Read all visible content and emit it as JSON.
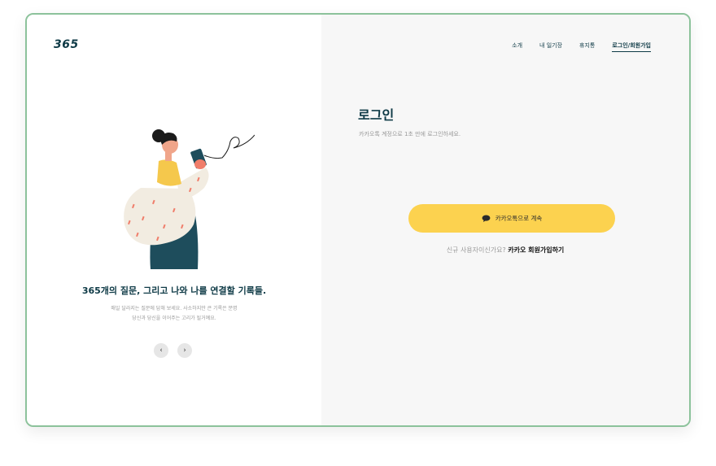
{
  "brand": {
    "logo": "365"
  },
  "nav": {
    "items": [
      {
        "label": "소개"
      },
      {
        "label": "내 일기장"
      },
      {
        "label": "휴지통"
      },
      {
        "label": "로그인/회원가입"
      }
    ],
    "active_index": 3
  },
  "intro": {
    "tagline": "365개의 질문, 그리고 나와 나를 연결할 기록들.",
    "desc_line1": "매일 달라지는 질문에 답해 보세요. 사소하지만 큰 기록은 분명",
    "desc_line2": "당신과 당신을 이어주는 고리가 될거예요."
  },
  "carousel": {
    "prev_icon": "‹",
    "next_icon": "›"
  },
  "login": {
    "title": "로그인",
    "subtitle": "카카오톡 계정으로 1초 만에 로그인하세요.",
    "kakao_button": "카카오톡으로 계속",
    "signup_prompt": "신규 사용자이신가요?",
    "signup_link": "카카오 회원가입하기"
  },
  "colors": {
    "accent": "#0e3a46",
    "kakao": "#fcd24f",
    "border": "#8cc29b"
  }
}
